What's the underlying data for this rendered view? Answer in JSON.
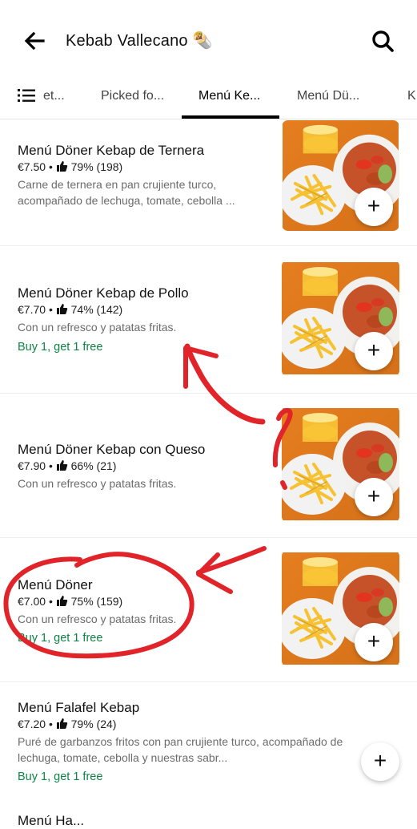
{
  "header": {
    "title": "Kebab Vallecano 🌯"
  },
  "tabs": [
    {
      "label": "et..."
    },
    {
      "label": "Picked fo..."
    },
    {
      "label": "Menú Ke..."
    },
    {
      "label": "Menú Dü..."
    },
    {
      "label": "K"
    }
  ],
  "items": [
    {
      "name": "Menú Döner Kebap de Ternera",
      "price": "€7.50",
      "rating": "79% (198)",
      "desc": "Carne de ternera en pan crujiente turco, acompañado de lechuga, tomate, cebolla ...",
      "promo": "",
      "add_label": "+"
    },
    {
      "name": "Menú Döner Kebap de Pollo",
      "price": "€7.70",
      "rating": "74% (142)",
      "desc": "Con un refresco y patatas fritas.",
      "promo": "Buy 1, get 1 free",
      "add_label": "+"
    },
    {
      "name": "Menú Döner Kebap con Queso",
      "price": "€7.90",
      "rating": "66% (21)",
      "desc": "Con un refresco y patatas fritas.",
      "promo": "",
      "add_label": "+"
    },
    {
      "name": "Menú Döner",
      "price": "€7.00",
      "rating": "75% (159)",
      "desc": "Con un refresco y patatas fritas.",
      "promo": "Buy 1, get 1 free",
      "add_label": "+"
    },
    {
      "name": "Menú Falafel Kebap",
      "price": "€7.20",
      "rating": "79% (24)",
      "desc": "Puré de garbanzos fritos con pan crujiente turco, acompañado de lechuga, tomate, cebolla y nuestras sabr...",
      "promo": "Buy 1, get 1 free",
      "add_label": "+"
    }
  ],
  "partial_item": {
    "name": "Menú Ha..."
  },
  "colors": {
    "promo": "#0e8345",
    "annotation": "#e0242a",
    "image_bg": "#e0791d"
  },
  "meta_separator": "•"
}
